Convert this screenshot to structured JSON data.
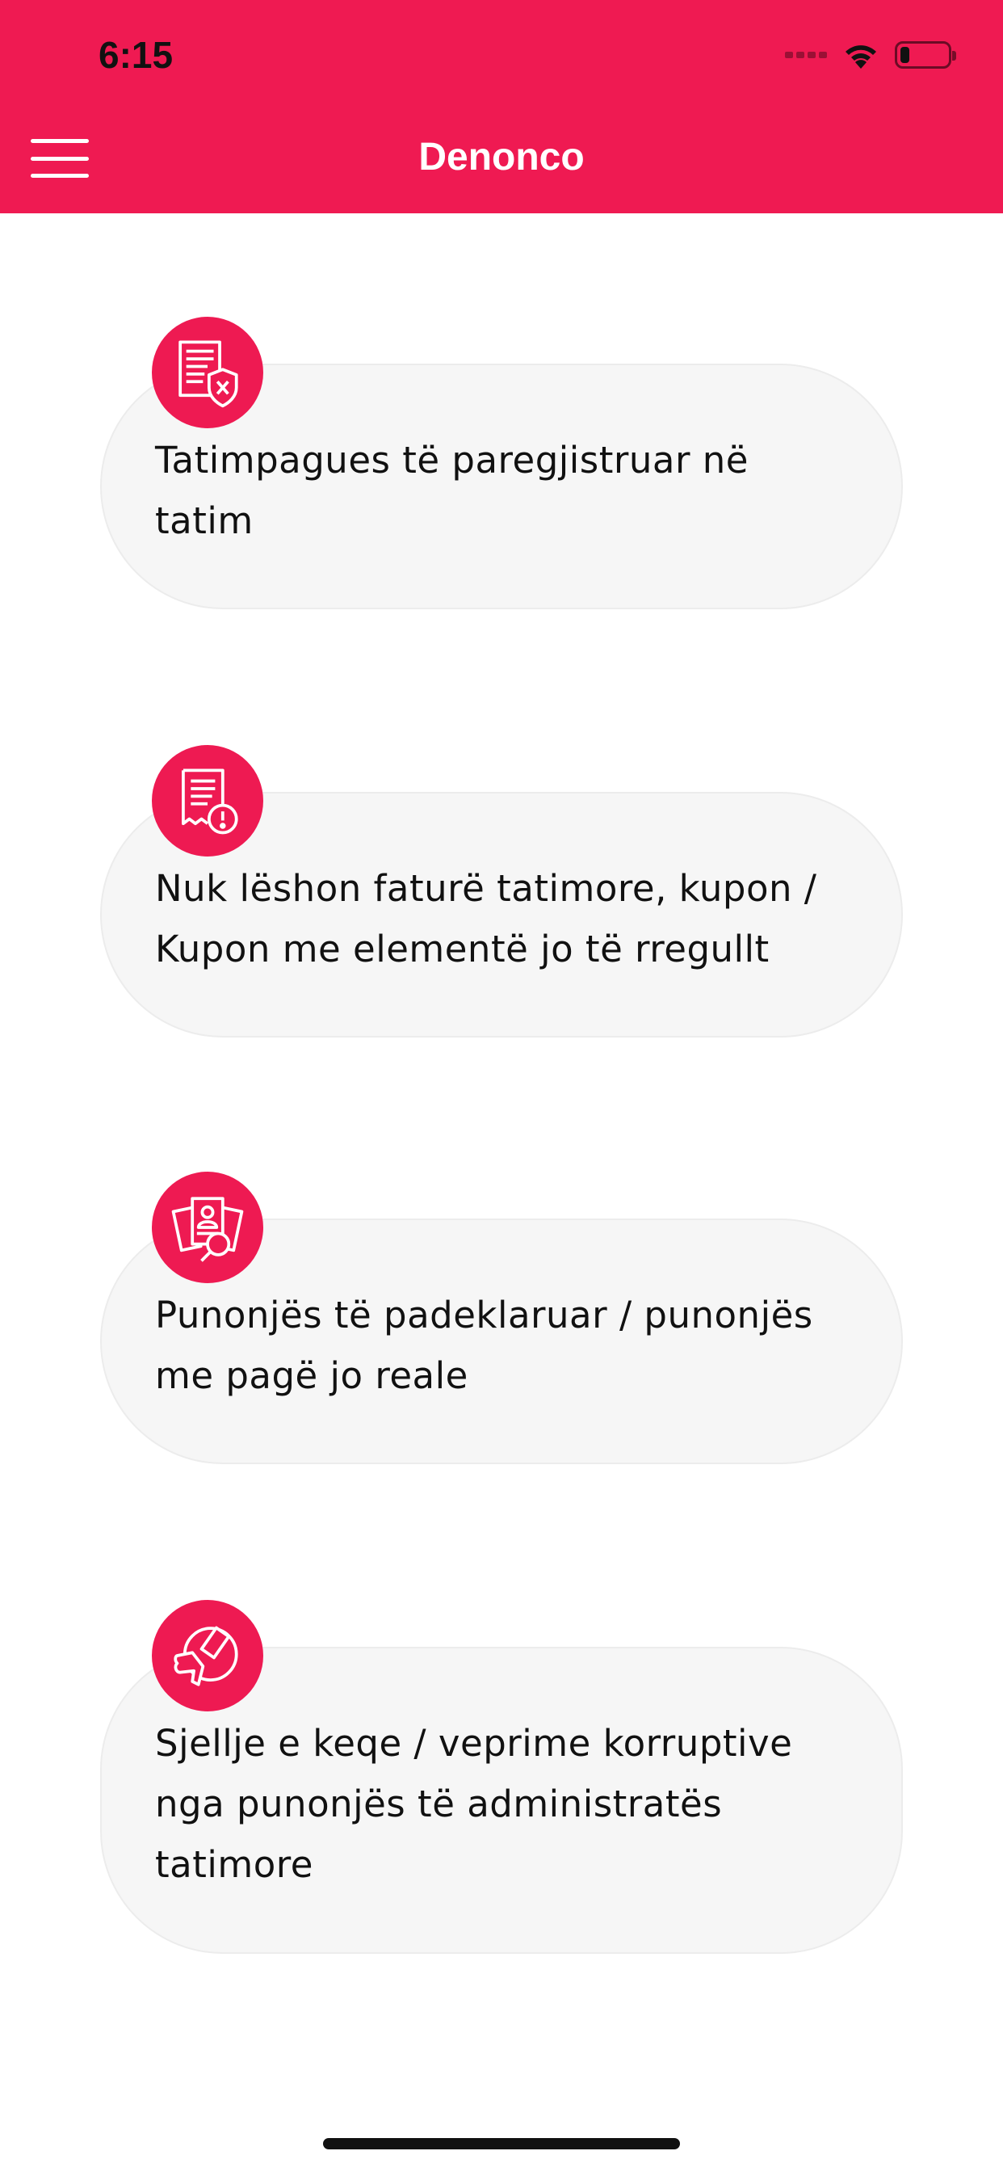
{
  "status_bar": {
    "time": "6:15",
    "battery_level_fraction": 0.2
  },
  "header": {
    "title": "Denonco",
    "menu_icon": "hamburger-menu-icon",
    "background_color": "#ef1a52"
  },
  "categories": [
    {
      "label": "Tatimpagues të paregjistruar në tatim",
      "icon": "unregistered-document-shield-icon"
    },
    {
      "label": "Nuk lëshon faturë tatimore, kupon / Kupon me elementë jo të rregullt",
      "icon": "receipt-warning-icon"
    },
    {
      "label": "Punonjës të padeklaruar / punonjës me pagë jo reale",
      "icon": "employee-documents-search-icon"
    },
    {
      "label": "Sjellje e keqe / veprime korruptive nga punonjës të administratës tatimore",
      "icon": "thumbs-down-icon"
    }
  ],
  "colors": {
    "accent": "#ee1a52",
    "card_background": "#f6f6f6",
    "text": "#111111"
  }
}
